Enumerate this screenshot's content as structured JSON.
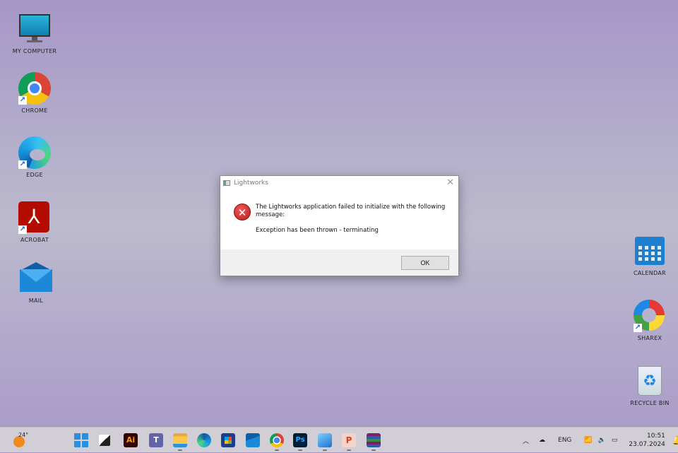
{
  "desktop": {
    "left_icons": [
      {
        "label": "MY COMPUTER",
        "icon": "monitor-icon"
      },
      {
        "label": "CHROME",
        "icon": "chrome-icon"
      },
      {
        "label": "EDGE",
        "icon": "edge-icon"
      },
      {
        "label": "ACROBAT",
        "icon": "acrobat-icon"
      },
      {
        "label": "MAIL",
        "icon": "mail-icon"
      }
    ],
    "right_icons": [
      {
        "label": "CALENDAR",
        "icon": "calendar-icon"
      },
      {
        "label": "SHAREX",
        "icon": "sharex-icon"
      },
      {
        "label": "RECYCLE BIN",
        "icon": "recycle-bin-icon"
      }
    ]
  },
  "dialog": {
    "title": "Lightworks",
    "message": "The Lightworks application failed to initialize with the following message:",
    "detail": "Exception has been thrown - terminating",
    "ok_label": "OK"
  },
  "taskbar": {
    "weather": "24°",
    "apps": [
      {
        "name": "start"
      },
      {
        "name": "task-view"
      },
      {
        "name": "illustrator",
        "text": "Ai"
      },
      {
        "name": "teams",
        "text": "T"
      },
      {
        "name": "file-explorer"
      },
      {
        "name": "edge"
      },
      {
        "name": "store"
      },
      {
        "name": "mail"
      },
      {
        "name": "chrome"
      },
      {
        "name": "photoshop",
        "text": "Ps"
      },
      {
        "name": "photos"
      },
      {
        "name": "powerpoint",
        "text": "P"
      },
      {
        "name": "winrar"
      }
    ],
    "language": "ENG",
    "time": "10:51",
    "date": "23.07.2024"
  }
}
